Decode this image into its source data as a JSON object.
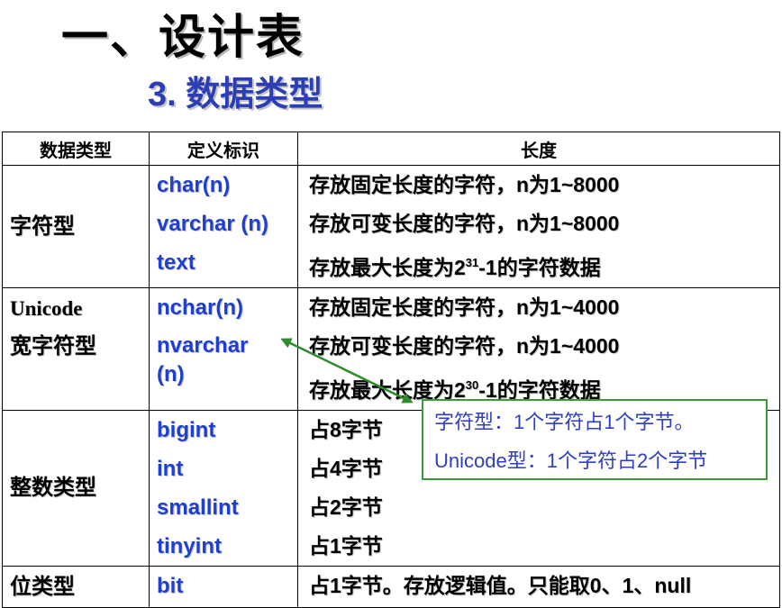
{
  "title": "一、设计表",
  "subtitle": "3. 数据类型",
  "table": {
    "headers": [
      "数据类型",
      "定义标识",
      "长度"
    ],
    "groups": [
      {
        "category": "字符型",
        "defs": [
          "char(n)",
          "varchar (n)",
          "text"
        ],
        "lengths": [
          "存放固定长度的字符，n为1~8000",
          "存放可变长度的字符，n为1~8000"
        ],
        "text_len_prefix": "存放最大长度为2",
        "text_len_exp": "31",
        "text_len_suffix": "-1的字符数据"
      },
      {
        "category_line1": "Unicode",
        "category_line2": "宽字符型",
        "defs": [
          "nchar(n)",
          "nvarchar (n)"
        ],
        "lengths": [
          "存放固定长度的字符，n为1~4000",
          "存放可变长度的字符，n为1~4000"
        ],
        "text_len_prefix": "存放最大长度为2",
        "text_len_exp": "30",
        "text_len_suffix": "-1的字符数据"
      },
      {
        "category": "整数类型",
        "defs": [
          "bigint",
          "int",
          "smallint",
          "tinyint"
        ],
        "lengths": [
          "占8字节",
          "占4字节",
          "占2字节",
          "占1字节"
        ]
      },
      {
        "category": "位类型",
        "defs": [
          "bit"
        ],
        "lengths": [
          "占1字节。存放逻辑值。只能取0、1、null"
        ]
      }
    ]
  },
  "callout": {
    "line1": "字符型：1个字符占1个字节。",
    "line2": "Unicode型：1个字符占2个字节"
  },
  "colors": {
    "subtitle": "#2b3fb3",
    "definition_text": "#1f3fcf",
    "callout_border": "#3a9a3a",
    "callout_text": "#2f3fc0",
    "arrow": "#2e8b2e"
  }
}
